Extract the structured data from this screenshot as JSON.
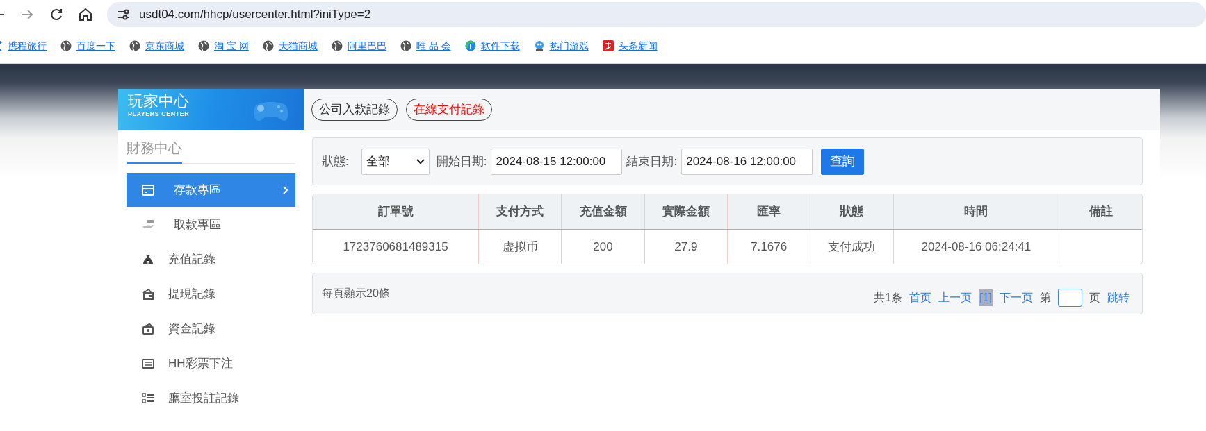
{
  "browser": {
    "url": "usdt04.com/hhcp/usercenter.html?iniType=2",
    "bookmarks": [
      {
        "label": "携程旅行",
        "kind": "partial"
      },
      {
        "label": "百度一下",
        "kind": "globe"
      },
      {
        "label": "京东商城",
        "kind": "globe"
      },
      {
        "label": "淘 宝 网",
        "kind": "globe"
      },
      {
        "label": "天猫商城",
        "kind": "globe"
      },
      {
        "label": "阿里巴巴",
        "kind": "globe"
      },
      {
        "label": "唯 品 会",
        "kind": "globe"
      },
      {
        "label": "软件下载",
        "kind": "download"
      },
      {
        "label": "热门游戏",
        "kind": "game"
      },
      {
        "label": "头条新闻",
        "kind": "news"
      }
    ]
  },
  "sidebar": {
    "title": "玩家中心",
    "subtitle": "PLAYERS CENTER",
    "section": "財務中心",
    "items": [
      {
        "label": "存款專區",
        "kind": "card",
        "selected": true
      },
      {
        "label": "取款專區",
        "kind": "hand",
        "selected": false
      },
      {
        "label": "充值記錄",
        "kind": "bag",
        "selected": false
      },
      {
        "label": "提現記錄",
        "kind": "wallet",
        "selected": false
      },
      {
        "label": "資金記錄",
        "kind": "cash",
        "selected": false
      },
      {
        "label": "HH彩票下注",
        "kind": "list",
        "selected": false
      },
      {
        "label": "廳室投註記錄",
        "kind": "grid",
        "selected": false
      }
    ]
  },
  "tabs": [
    {
      "label": "公司入款記錄",
      "selected": false
    },
    {
      "label": "在線支付記錄",
      "selected": true
    }
  ],
  "filter": {
    "status_label": "狀態:",
    "status_value": "全部",
    "start_label": "開始日期:",
    "start_value": "2024-08-15 12:00:00",
    "end_label": "結束日期:",
    "end_value": "2024-08-16 12:00:00",
    "button": "查詢"
  },
  "table": {
    "columns": [
      "訂單號",
      "支付方式",
      "充值金額",
      "實際金額",
      "匯率",
      "狀態",
      "時間",
      "備註"
    ],
    "rows": [
      [
        "1723760681489315",
        "虚拟币",
        "200",
        "27.9",
        "7.1676",
        "支付成功",
        "2024-08-16 06:24:41",
        ""
      ]
    ]
  },
  "pagination": {
    "page_size_text": "每頁顯示20條",
    "total": "共1条",
    "first": "首页",
    "prev": "上一页",
    "current": "[1]",
    "next": "下一页",
    "goto_prefix": "第",
    "goto_suffix": "页",
    "goto": "跳转"
  }
}
